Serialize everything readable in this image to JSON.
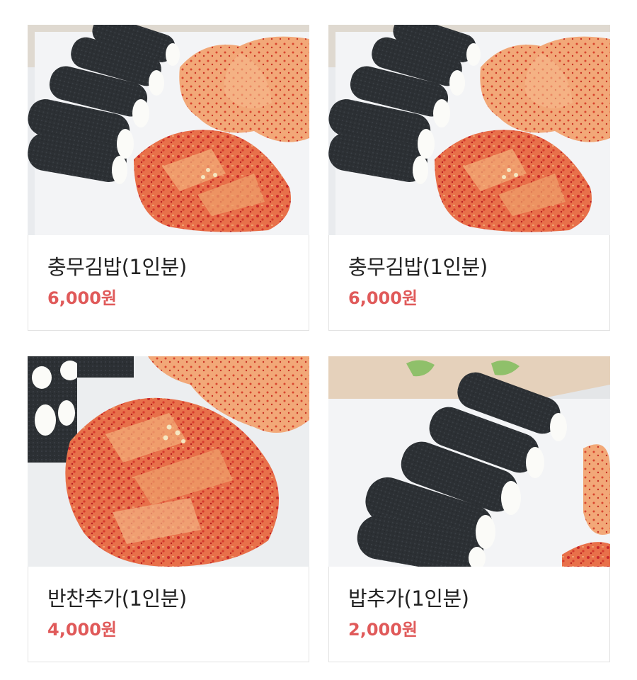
{
  "accent_color": "#e05a5a",
  "products": [
    {
      "name": "충무김밥(1인분)",
      "price": "6,000원",
      "image": "kimbap-with-kimchi-photo"
    },
    {
      "name": "충무김밥(1인분)",
      "price": "6,000원",
      "image": "kimbap-with-kimchi-photo"
    },
    {
      "name": "반찬추가(1인분)",
      "price": "4,000원",
      "image": "side-dish-kimchi-photo"
    },
    {
      "name": "밥추가(1인분)",
      "price": "2,000원",
      "image": "seaweed-rice-rolls-photo"
    }
  ]
}
